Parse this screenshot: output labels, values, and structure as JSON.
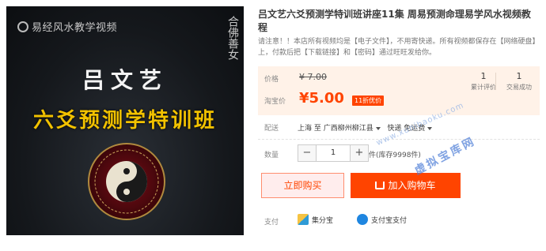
{
  "product_image": {
    "top_watermark": "易经风水教学视频",
    "side_mark": "合佛善女",
    "cover_title": "吕文艺",
    "cover_subtitle": "六爻预测学特训班"
  },
  "product": {
    "title": "吕文艺六爻预测学特训班讲座11集 周易预测命理易学风水视频教程",
    "notice": "请注意！！本店所有视频均是【电子文件】，不用寄快递。所有视频都保存在【网络硬盘】上，付款后把【下载链接】和【密码】通过旺旺发给你。"
  },
  "pricing": {
    "price_label": "价格",
    "old_price": "¥ 7.00",
    "promo_label": "淘宝价",
    "new_price": "¥5.00",
    "promo_badge": "11折优价",
    "stats": [
      {
        "num": "1",
        "label": "累计评价"
      },
      {
        "num": "1",
        "label": "交易成功"
      }
    ]
  },
  "shipping": {
    "label": "配送",
    "destination": "上海 至  广西柳州柳江县",
    "method": "快递 免运费"
  },
  "quantity": {
    "label": "数量",
    "minus": "−",
    "value": "1",
    "plus": "+",
    "stock": "件(库存9998件)"
  },
  "actions": {
    "buy_now": "立即购买",
    "add_to_cart": "加入购物车"
  },
  "payment": {
    "label": "支付",
    "methods": [
      {
        "name": "集分宝",
        "icon": "jifenbao-icon",
        "color": "#2f9bd6"
      },
      {
        "name": "支付宝支付",
        "icon": "alipay-icon",
        "color": "#1f86e0"
      }
    ]
  },
  "overlay_watermark": {
    "url": "www.xunibaoku.com",
    "name": "虚拟宝库网"
  },
  "colors": {
    "accent": "#ff4400",
    "price_bg": "#fff2e8"
  }
}
